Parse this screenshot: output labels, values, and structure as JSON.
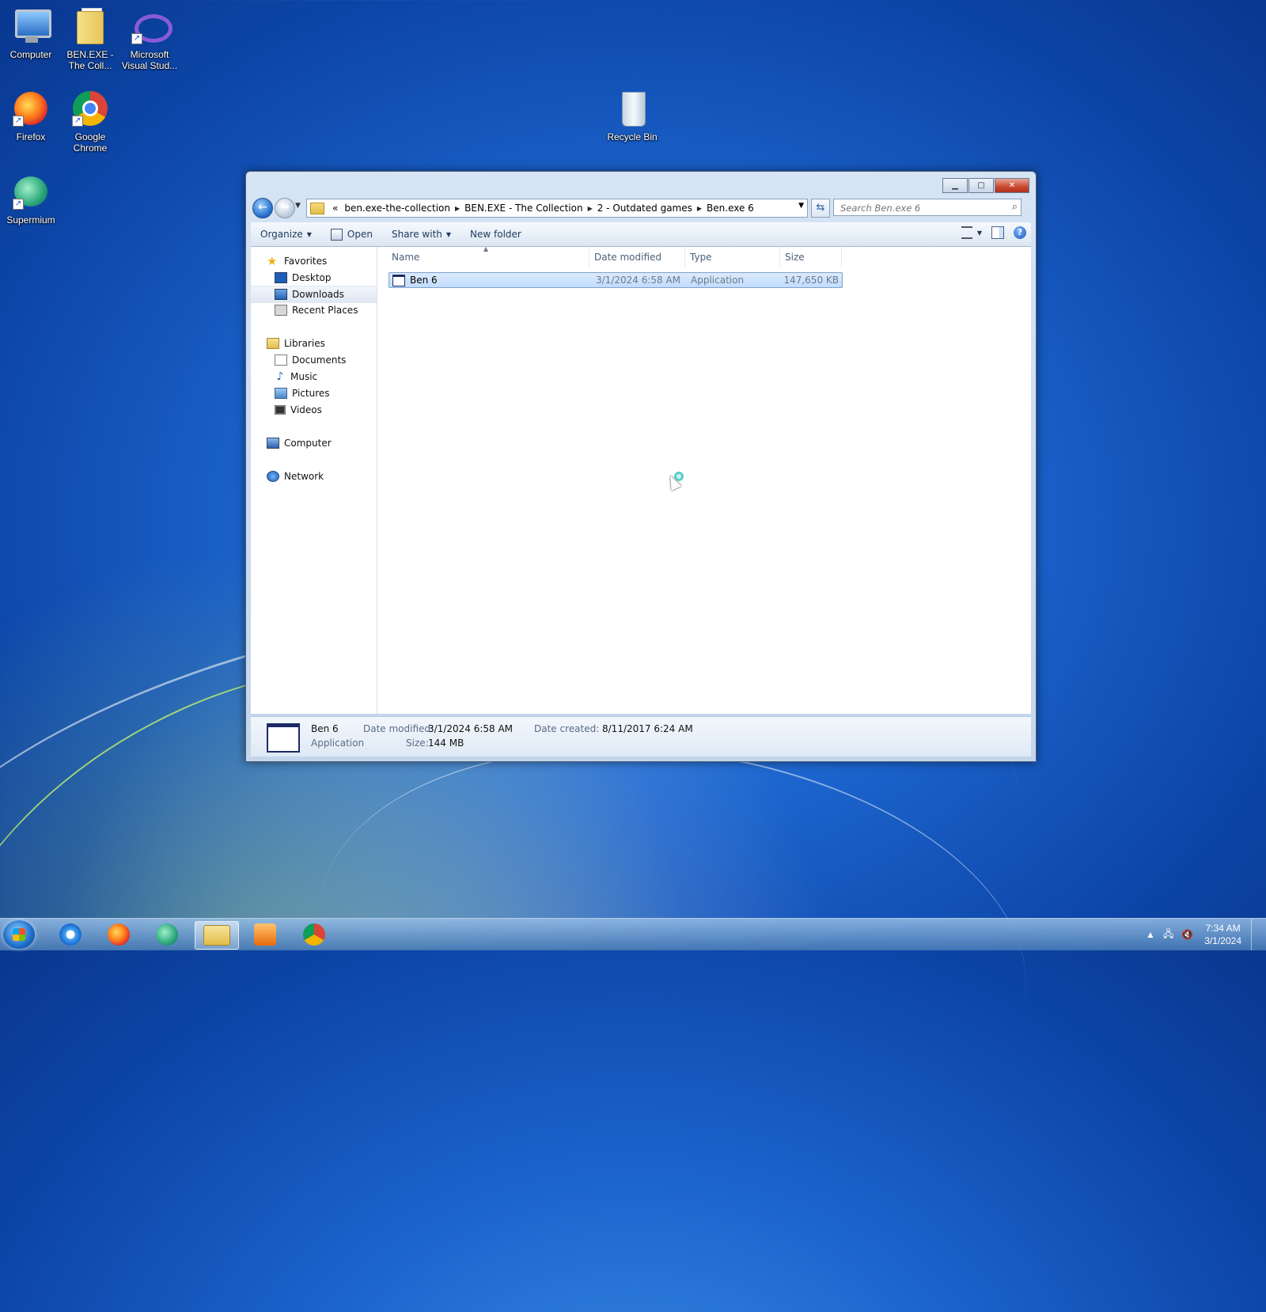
{
  "desktop": {
    "icons": [
      {
        "label": "Computer",
        "icon": "computer-icon"
      },
      {
        "label": "BEN.EXE - The Coll...",
        "icon": "folder-icon"
      },
      {
        "label": "Microsoft Visual Stud...",
        "icon": "visual-studio-icon"
      },
      {
        "label": "Firefox",
        "icon": "firefox-icon"
      },
      {
        "label": "Google Chrome",
        "icon": "chrome-icon"
      },
      {
        "label": "Supermium",
        "icon": "supermium-icon"
      },
      {
        "label": "Recycle Bin",
        "icon": "recycle-bin-icon"
      }
    ]
  },
  "window": {
    "address": {
      "overflow": "«",
      "crumbs": [
        "ben.exe-the-collection",
        "BEN.EXE - The Collection",
        "2 - Outdated games",
        "Ben.exe 6"
      ]
    },
    "search": {
      "placeholder": "Search Ben.exe 6"
    },
    "toolbar": {
      "organize": "Organize",
      "open": "Open",
      "share_with": "Share with",
      "new_folder": "New folder"
    },
    "nav": {
      "favorites": "Favorites",
      "desktop": "Desktop",
      "downloads": "Downloads",
      "recent_places": "Recent Places",
      "libraries": "Libraries",
      "documents": "Documents",
      "music": "Music",
      "pictures": "Pictures",
      "videos": "Videos",
      "computer": "Computer",
      "network": "Network"
    },
    "columns": {
      "name": "Name",
      "date_modified": "Date modified",
      "type": "Type",
      "size": "Size"
    },
    "files": [
      {
        "name": "Ben 6",
        "date_modified": "3/1/2024 6:58 AM",
        "type": "Application",
        "size": "147,650 KB"
      }
    ],
    "details": {
      "name": "Ben 6",
      "type": "Application",
      "date_modified_label": "Date modified:",
      "date_modified": "3/1/2024 6:58 AM",
      "size_label": "Size:",
      "size": "144 MB",
      "date_created_label": "Date created:",
      "date_created": "8/11/2017 6:24 AM"
    }
  },
  "taskbar": {
    "apps": [
      "internet-explorer-icon",
      "firefox-icon",
      "supermium-icon",
      "windows-explorer-icon",
      "media-player-icon",
      "chrome-icon"
    ],
    "clock": {
      "time": "7:34 AM",
      "date": "3/1/2024"
    }
  }
}
